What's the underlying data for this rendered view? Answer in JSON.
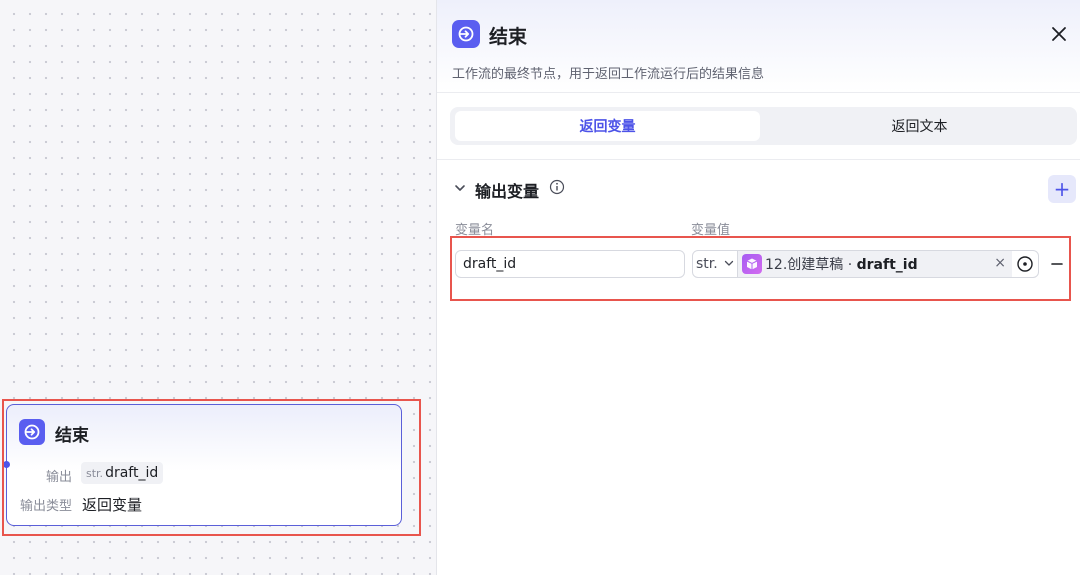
{
  "canvas": {
    "node": {
      "title": "结束",
      "output_label": "输出",
      "output_type_tag": "str.",
      "output_var": "draft_id",
      "output_kind_label": "输出类型",
      "output_kind_value": "返回变量"
    }
  },
  "panel": {
    "title": "结束",
    "description": "工作流的最终节点，用于返回工作流运行后的结果信息",
    "tabs": [
      {
        "label": "返回变量",
        "active": true
      },
      {
        "label": "返回文本",
        "active": false
      }
    ],
    "section": {
      "title": "输出变量",
      "col_name": "变量名",
      "col_value": "变量值",
      "rows": [
        {
          "name": "draft_id",
          "type": "str.",
          "ref_node": "12.创建草稿",
          "ref_sep": " · ",
          "ref_var": "draft_id"
        }
      ]
    }
  },
  "colors": {
    "accent": "#4d53e8",
    "node_icon": "#5a5ef0",
    "ref_icon": "#b262f1",
    "highlight": "#e8554d"
  },
  "icons": [
    "end-node-icon",
    "close-icon",
    "chevron-down-icon",
    "info-icon",
    "plus-icon",
    "cube-icon",
    "target-icon",
    "minus-icon"
  ]
}
